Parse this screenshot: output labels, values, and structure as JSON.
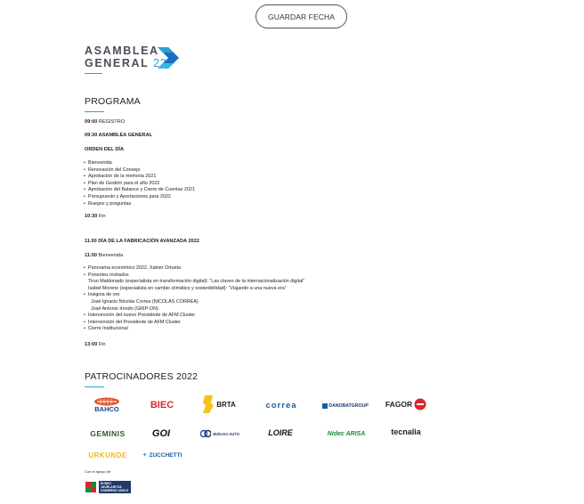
{
  "header": {
    "save_label": "GUARDAR FECHA"
  },
  "logo": {
    "line1": "ASAMBLEA",
    "line2": "GENERAL",
    "year": "22"
  },
  "program": {
    "title": "PROGRAMA",
    "t0900_time": "09:00",
    "t0900_text": " REGISTRO",
    "t0930": "09:30 ASAMBLEA GENERAL",
    "orden": "ORDEN DEL DÍA",
    "items1": [
      "Bienvenida",
      "Renovación del Consejo",
      "Aprobación de la memoria 2021",
      "Plan de Gestión para el año 2022",
      "Aprobación del Balance y Cierre de Cuentas 2021",
      "Presupuesto y Aportaciones para 2022",
      "Ruegos y preguntas"
    ],
    "t1030_time": "10:30",
    "t1030_text": " Fin",
    "t1100": "11.00 DÍA DE LA FABRICACIÓN AVANZADA 2022",
    "t1100b_time": "11:00",
    "t1100b_text": " Bienvenida",
    "items2": [
      "Panorama económico 2022, Xabier Ortueta",
      "Ponentes invitados",
      "Tirso Maldonado (especialista en transformación digital): “Las claves de la internacionalización digital”",
      "Isabel Moreno (especialista en cambio climático y sostenibilidad): “Viajando a una nueva era”",
      "Insignia de oro",
      "José Ignacio Nicolás Correa (NICOLÁS CORREA)",
      "José Antonio Irondo (GRIP-ON)",
      "Intervención del nuevo Presidente de AFM Cluster",
      "Intervención del Presidente de AFM Cluster",
      "Cierre Institucional"
    ],
    "t1300_time": "13:00",
    "t1300_text": " Fin"
  },
  "sponsors": {
    "title": "PATROCINADORES 2022",
    "row1": [
      "BAHCO",
      "BIEC",
      "BRTA",
      "correa",
      "DANOBATGROUP",
      "FAGOR"
    ],
    "row2": [
      "GEMINIS",
      "GOI",
      "BIZKAIA AUTO",
      "LOIRE",
      "Nidec ARISA",
      "tecnalia"
    ],
    "row3": [
      "URKUNDE",
      "ZUCCHETTI"
    ],
    "support_label": "Con el apoyo de",
    "gov_text": "EUSKO JAURLARITZA GOBIERNO VASCO"
  },
  "colors": {
    "accent": "#2aa0d8",
    "fagor_red": "#d6282b",
    "bahco_orange": "#e0582a",
    "correa_blue": "#1f5aa8",
    "brta_yellow": "#f3c21b",
    "urkunde_yellow": "#f1b81c"
  }
}
